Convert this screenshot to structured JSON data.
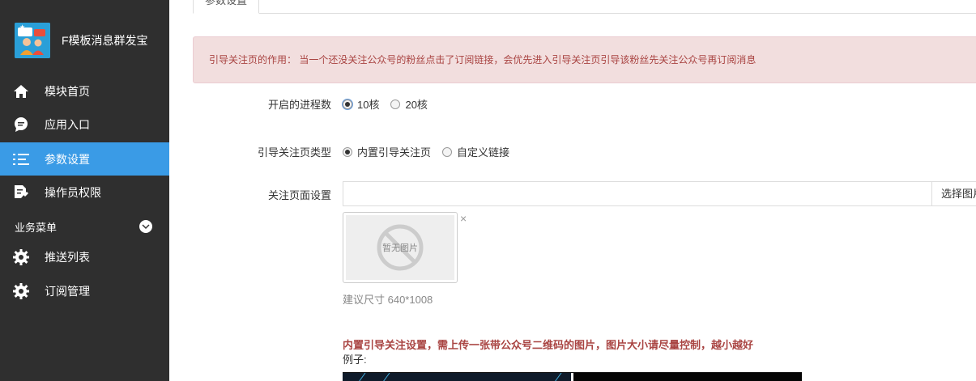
{
  "sidebar": {
    "brand_title": "F模板消息群发宝",
    "items": [
      {
        "label": "模块首页",
        "icon": "home-icon"
      },
      {
        "label": "应用入口",
        "icon": "chat-bubble-icon"
      },
      {
        "label": "参数设置",
        "icon": "list-icon",
        "active": true
      },
      {
        "label": "操作员权限",
        "icon": "document-edit-icon"
      }
    ],
    "section_label": "业务菜单",
    "section_items": [
      {
        "label": "推送列表",
        "icon": "gear-icon"
      },
      {
        "label": "订阅管理",
        "icon": "gear-icon"
      }
    ],
    "active_color": "#3a9be6"
  },
  "tabs": [
    {
      "label": "参数设置"
    }
  ],
  "alert": {
    "text": "引导关注页的作用： 当一个还没关注公众号的粉丝点击了订阅链接，会优先进入引导关注页引导该粉丝先关注公众号再订阅消息"
  },
  "form": {
    "process_count": {
      "label": "开启的进程数",
      "options": [
        "10核",
        "20核"
      ],
      "selected": "10核"
    },
    "guide_type": {
      "label": "引导关注页类型",
      "options": [
        "内置引导关注页",
        "自定义链接"
      ],
      "selected": "内置引导关注页"
    },
    "page_setting": {
      "label": "关注页面设置",
      "value": "",
      "button_label": "选择图片",
      "no_image_text": "暂无图片",
      "close_symbol": "×",
      "size_hint": "建议尺寸 640*1008"
    },
    "builtin_notice": "内置引导关注设置，需上传一张带公众号二维码的图片，图片大小请尽量控制，越小越好",
    "example_label": "例子:"
  }
}
